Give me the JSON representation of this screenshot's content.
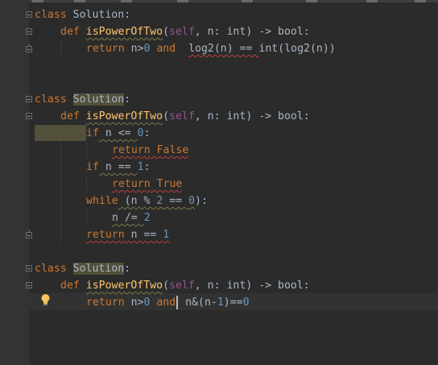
{
  "editor": {
    "blocks": [
      {
        "class_line": {
          "kw": "class",
          "name": "Solution",
          "colon": ":"
        },
        "def_line": {
          "kw": "def",
          "fn": "isPowerOfTwo",
          "open": "(",
          "self": "self",
          "params": ", n: ",
          "type1": "int",
          "close": ") -> ",
          "ret": "bool",
          "colon": ":"
        },
        "body": [
          {
            "kw": "return",
            "a": " n>",
            "n0": "0",
            "and": " and ",
            "b": "log2(n) == ",
            "int": "int",
            "c": "(log2(n))"
          }
        ]
      },
      {
        "class_line": {
          "kw": "class",
          "name": "Solution",
          "colon": ":"
        },
        "def_line": {
          "kw": "def",
          "fn": "isPowerOfTwo",
          "open": "(",
          "self": "self",
          "params": ", n: ",
          "type1": "int",
          "close": ") -> ",
          "ret": "bool",
          "colon": ":"
        },
        "lines": {
          "if1_kw": "if",
          "if1_a": " n <= ",
          "if1_num": "0",
          "if1_colon": ":",
          "ret_false_kw": "return",
          "ret_false_val": " False",
          "if2_kw": "if",
          "if2_a": " n == ",
          "if2_num": "1",
          "if2_colon": ":",
          "ret_true_kw": "return",
          "ret_true_val": " True",
          "while_kw": "while",
          "while_a": " (n % ",
          "while_n2": "2",
          "while_b": " == ",
          "while_n0": "0",
          "while_c": "):",
          "div_a": "n /= ",
          "div_num": "2",
          "ret_last_kw": "return",
          "ret_last_a": " n == ",
          "ret_last_num": "1"
        }
      },
      {
        "class_line": {
          "kw": "class",
          "name": "Solution",
          "colon": ":"
        },
        "def_line": {
          "kw": "def",
          "fn": "isPowerOfTwo",
          "open": "(",
          "self": "self",
          "params": ", n: ",
          "type1": "int",
          "close": ") -> ",
          "ret": "bool",
          "colon": ":"
        },
        "body": [
          {
            "kw": "return",
            "a": " n>",
            "n0": "0",
            "and": " and",
            "b": " n&(n-",
            "n1": "1",
            "c": ")==",
            "n2": "0"
          }
        ]
      }
    ]
  },
  "icons": {
    "intention": "lightbulb-icon",
    "fold": "fold-marker-icon"
  },
  "colors": {
    "background": "#2b2b2b",
    "keyword": "#cc7832",
    "function": "#ffc66d",
    "self": "#94558d",
    "number": "#6897bb",
    "text": "#a9b7c6"
  }
}
